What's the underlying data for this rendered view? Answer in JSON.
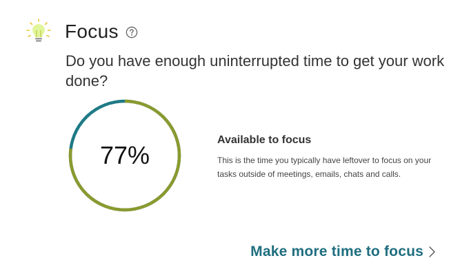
{
  "header": {
    "icon": "lightbulb-icon",
    "title": "Focus",
    "help_icon": "question-circle-icon"
  },
  "question": "Do you have enough uninterrupted time to get your work done?",
  "focus_stat": {
    "value_label": "77%",
    "fraction": 0.77,
    "colors": {
      "focus": "#8a9a2f",
      "other": "#1f7a86"
    }
  },
  "info": {
    "heading": "Available to focus",
    "description": "This is the time you typically have leftover to focus on your tasks outside of meetings, emails, chats and calls."
  },
  "cta": {
    "label": "Make more time to focus",
    "icon": "chevron-right-icon"
  }
}
